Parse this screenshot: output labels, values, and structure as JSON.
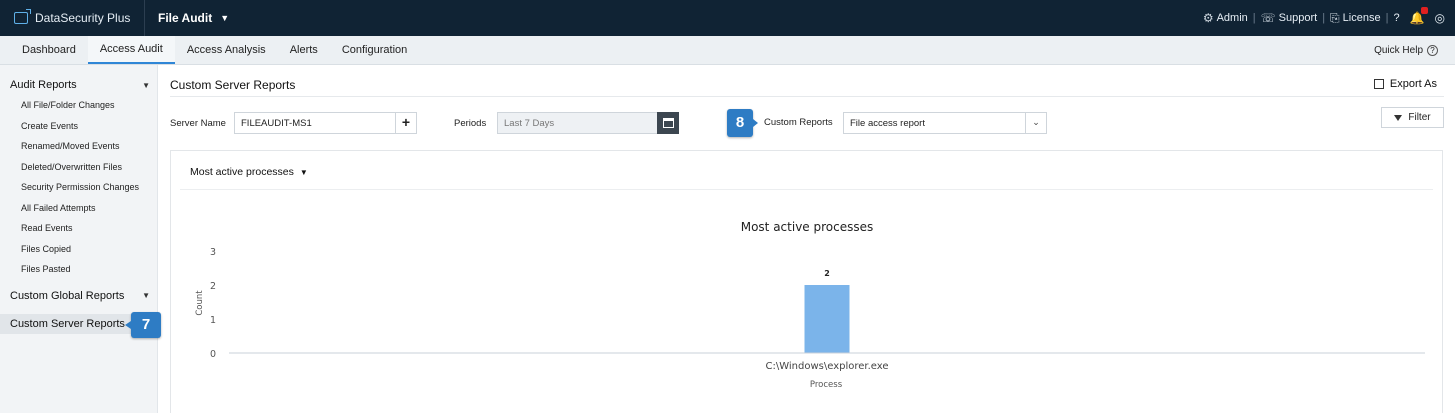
{
  "header": {
    "brand": "DataSecurity Plus",
    "module": "File Audit",
    "links": [
      "Admin",
      "Support",
      "License"
    ],
    "help_glyph": "?"
  },
  "nav": {
    "tabs": [
      "Dashboard",
      "Access Audit",
      "Access Analysis",
      "Alerts",
      "Configuration"
    ],
    "active_tab": "Access Audit",
    "quick_help": "Quick Help"
  },
  "sidebar": {
    "audit_reports": "Audit Reports",
    "items": [
      "All File/Folder Changes",
      "Create Events",
      "Renamed/Moved Events",
      "Deleted/Overwritten Files",
      "Security Permission Changes",
      "All Failed Attempts",
      "Read Events",
      "Files Copied",
      "Files Pasted"
    ],
    "custom_global": "Custom Global Reports",
    "custom_server": "Custom Server Reports",
    "badge": "7"
  },
  "main": {
    "title": "Custom Server Reports",
    "export": "Export As",
    "server_label": "Server Name",
    "server_value": "FILEAUDIT-MS1",
    "periods_label": "Periods",
    "periods_placeholder": "Last 7 Days",
    "badge": "8",
    "custom_reports_label": "Custom Reports",
    "custom_reports_value": "File access report",
    "filter": "Filter",
    "panel_dropdown": "Most active processes"
  },
  "chart_data": {
    "type": "bar",
    "title": "Most active processes",
    "xlabel": "Process",
    "ylabel": "Count",
    "categories": [
      "C:\\Windows\\explorer.exe"
    ],
    "values": [
      2
    ],
    "data_labels": [
      "2"
    ],
    "yticks": [
      "0",
      "1",
      "2",
      "3"
    ],
    "ylim": [
      0,
      3
    ],
    "bar_color": "#7bb4ea",
    "grid": false
  },
  "colors": {
    "topbar": "#102334",
    "accent": "#2f86d6",
    "badge": "#2e7cc4"
  }
}
